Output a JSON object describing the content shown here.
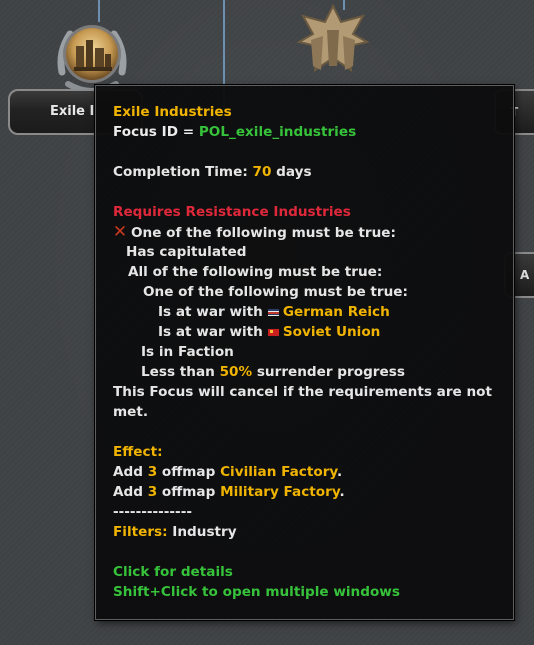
{
  "background": {
    "focus_label_left": "Exile I",
    "focus_label_right_fragment": "T",
    "side_pill_fragment": "A"
  },
  "tooltip": {
    "title": "Exile Industries",
    "focus_id_label": "Focus ID = ",
    "focus_id_value": "POL_exile_industries",
    "completion_label": "Completion Time: ",
    "completion_value": "70",
    "completion_unit": " days",
    "requires_label": "Requires Resistance Industries",
    "one_of_following": "One of the following must be true:",
    "has_capitulated": "Has capitulated",
    "all_of_following": "All of the following must be true:",
    "one_of_following_2": "One of the following must be true:",
    "at_war_with_1": "Is at war with",
    "country_1": "German Reich",
    "at_war_with_2": "Is at war with",
    "country_2": "Soviet Union",
    "in_faction": "Is in Faction",
    "less_than": "Less than ",
    "surrender_pct": "50%",
    "surrender_text": " surrender progress",
    "cancel_line_1": "This Focus will cancel if the requirements are not",
    "cancel_line_2": "met.",
    "effect_label": "Effect:",
    "effect_1_prefix": "Add ",
    "effect_1_count": "3",
    "effect_1_mid": " offmap ",
    "effect_1_item": "Civilian Factory",
    "effect_1_end": ".",
    "effect_2_prefix": "Add ",
    "effect_2_count": "3",
    "effect_2_mid": " offmap ",
    "effect_2_item": "Military Factory",
    "effect_2_end": ".",
    "separator": "--------------",
    "filters_label": "Filters: ",
    "filters_value": "Industry",
    "click_details": "Click for details",
    "shift_click": "Shift+Click to open multiple windows"
  },
  "colors": {
    "highlight": "#f0b400",
    "positive": "#36c23a",
    "negative": "#e0283b",
    "text": "#e6e6e6"
  },
  "icons": {
    "requirement_status": "red-cross-icon",
    "country_1_flag": "german-reich-flag-icon",
    "country_2_flag": "soviet-union-flag-icon"
  }
}
